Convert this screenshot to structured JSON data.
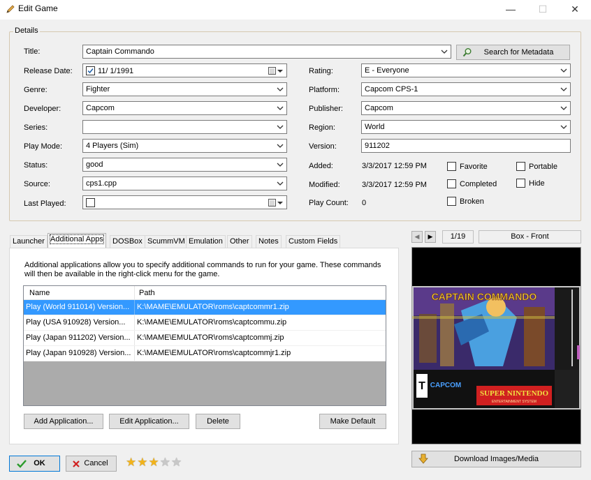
{
  "window": {
    "title": "Edit Game",
    "minimize_glyph": "—",
    "maximize_glyph": "☐",
    "close_glyph": "✕"
  },
  "details": {
    "legend": "Details",
    "title_label": "Title:",
    "title_value": "Captain Commando",
    "search_button": "Search for Metadata",
    "release_label": "Release Date:",
    "release_value": "11/  1/1991",
    "genre_label": "Genre:",
    "genre_value": "Fighter",
    "developer_label": "Developer:",
    "developer_value": "Capcom",
    "series_label": "Series:",
    "series_value": "",
    "playmode_label": "Play Mode:",
    "playmode_value": "4 Players (Sim)",
    "status_label": "Status:",
    "status_value": "good",
    "source_label": "Source:",
    "source_value": "cps1.cpp",
    "lastplayed_label": "Last Played:",
    "lastplayed_value": "",
    "rating_label": "Rating:",
    "rating_value": "E - Everyone",
    "platform_label": "Platform:",
    "platform_value": "Capcom CPS-1",
    "publisher_label": "Publisher:",
    "publisher_value": "Capcom",
    "region_label": "Region:",
    "region_value": "World",
    "version_label": "Version:",
    "version_value": "911202",
    "added_label": "Added:",
    "added_value": "3/3/2017 12:59 PM",
    "modified_label": "Modified:",
    "modified_value": "3/3/2017 12:59 PM",
    "playcount_label": "Play Count:",
    "playcount_value": "0",
    "favorite_label": "Favorite",
    "completed_label": "Completed",
    "broken_label": "Broken",
    "portable_label": "Portable",
    "hide_label": "Hide"
  },
  "tabs": [
    {
      "label": "Launcher"
    },
    {
      "label": "Additional Apps"
    },
    {
      "label": "DOSBox"
    },
    {
      "label": "ScummVM"
    },
    {
      "label": "Emulation"
    },
    {
      "label": "Other"
    },
    {
      "label": "Notes"
    },
    {
      "label": "Custom Fields"
    }
  ],
  "apps": {
    "description": "Additional applications allow you to specify additional commands to run for your game.  These commands will then be available in the right-click menu for the game.",
    "columns": [
      "Name",
      "Path"
    ],
    "rows": [
      {
        "name": "Play (World 911014) Version...",
        "path": "K:\\MAME\\EMULATOR\\roms\\captcommr1.zip"
      },
      {
        "name": "Play (USA 910928) Version...",
        "path": "K:\\MAME\\EMULATOR\\roms\\captcommu.zip"
      },
      {
        "name": "Play (Japan 911202) Version...",
        "path": "K:\\MAME\\EMULATOR\\roms\\captcommj.zip"
      },
      {
        "name": "Play (Japan 910928) Version...",
        "path": "K:\\MAME\\EMULATOR\\roms\\captcommjr1.zip"
      }
    ],
    "add_button": "Add Application...",
    "edit_button": "Edit Application...",
    "delete_button": "Delete",
    "default_button": "Make Default"
  },
  "media": {
    "prev_glyph": "◀",
    "next_glyph": "▶",
    "counter": "1/19",
    "image_type": "Box - Front",
    "download_button": "Download Images/Media",
    "cover_title": "CAPTAIN COMMANDO",
    "rating_badge": "T",
    "publisher_logo": "CAPCOM",
    "console_logo": "SUPER NINTENDO",
    "console_sub": "ENTERTAINMENT SYSTEM"
  },
  "footer": {
    "ok_button": "OK",
    "cancel_button": "Cancel",
    "star_rating": 3,
    "star_max": 5
  },
  "colors": {
    "selection": "#3399ff",
    "star_filled": "#f2b31a",
    "star_empty": "#c8c8c8",
    "ok_border": "#0078d7"
  }
}
